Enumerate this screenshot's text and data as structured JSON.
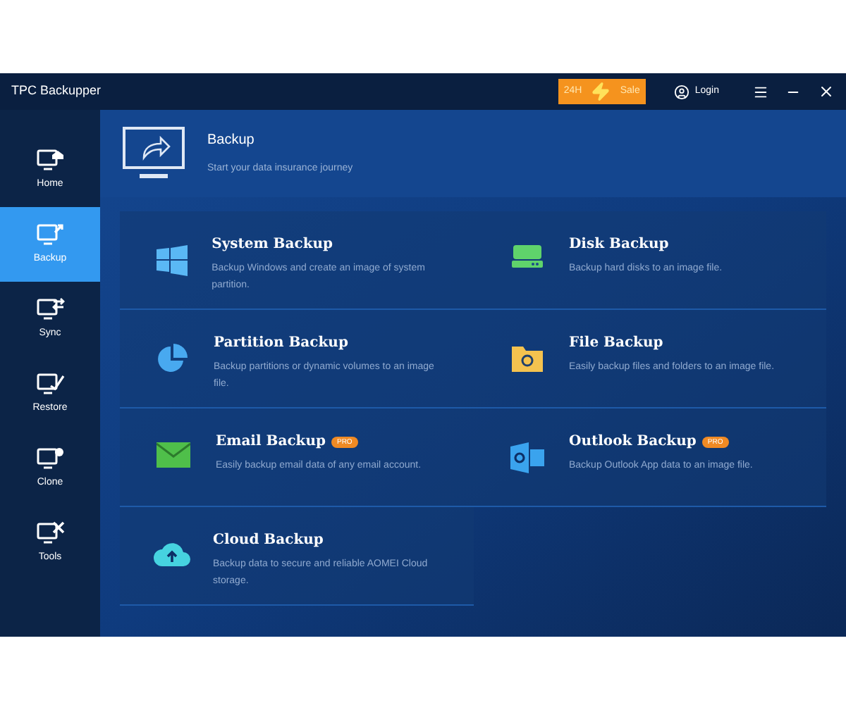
{
  "window": {
    "title": "TPC Backupper"
  },
  "sale_button": {
    "left": "24H",
    "right": "Sale"
  },
  "login": {
    "label": "Login"
  },
  "sidebar": {
    "items": [
      {
        "label": "Home",
        "kind": "home",
        "selected": false
      },
      {
        "label": "Backup",
        "kind": "backup",
        "selected": true
      },
      {
        "label": "Sync",
        "kind": "sync",
        "selected": false
      },
      {
        "label": "Restore",
        "kind": "restore",
        "selected": false
      },
      {
        "label": "Clone",
        "kind": "clone",
        "selected": false
      },
      {
        "label": "Tools",
        "kind": "tools",
        "selected": false
      }
    ]
  },
  "header": {
    "title": "Backup",
    "subtitle": "Start your data insurance journey"
  },
  "options": [
    {
      "title": "System Backup",
      "description": "Backup Windows and create an image of system partition.",
      "kind": "windows"
    },
    {
      "title": "Disk Backup",
      "description": "Backup hard disks to an image file.",
      "kind": "disk"
    },
    {
      "title": "Partition Backup",
      "description": "Backup partitions or dynamic volumes to an image file.",
      "kind": "partition"
    },
    {
      "title": "File Backup",
      "description": "Easily backup files and folders to an image file.",
      "kind": "file"
    },
    {
      "title": "Email Backup",
      "description": "Easily backup email data of any email account.",
      "kind": "email",
      "badge": "PRO"
    },
    {
      "title": "Outlook Backup",
      "description": "Backup Outlook App data to an image file.",
      "kind": "outlook",
      "badge": "PRO"
    },
    {
      "title": "Cloud Backup",
      "description": "Backup data to secure and reliable AOMEI Cloud storage.",
      "kind": "cloud"
    }
  ]
}
